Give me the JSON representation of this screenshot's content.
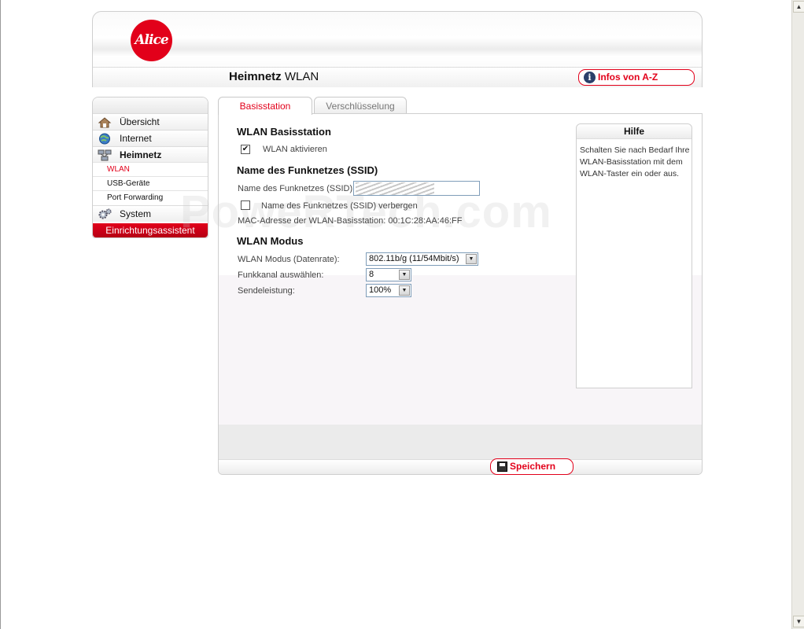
{
  "header": {
    "logo_text": "Alice",
    "page_title_bold": "Heimnetz",
    "page_title_rest": " WLAN",
    "infos_button": "Infos von A-Z"
  },
  "sidebar": {
    "items": [
      {
        "label": "Übersicht",
        "icon": "home-icon"
      },
      {
        "label": "Internet",
        "icon": "globe-icon"
      },
      {
        "label": "Heimnetz",
        "icon": "network-icon"
      }
    ],
    "subitems": [
      {
        "label": "WLAN",
        "active": true
      },
      {
        "label": "USB-Geräte",
        "active": false
      },
      {
        "label": "Port Forwarding",
        "active": false
      }
    ],
    "system": {
      "label": "System",
      "icon": "gear-icon"
    },
    "wizard": "Einrichtungsassistent"
  },
  "tabs": [
    {
      "label": "Basisstation",
      "active": true
    },
    {
      "label": "Verschlüsselung",
      "active": false
    }
  ],
  "content": {
    "section1_title": "WLAN Basisstation",
    "wlan_enable_label": "WLAN aktivieren",
    "wlan_enable_checked": true,
    "section2_title": "Name des Funknetzes (SSID)",
    "ssid_label": "Name des Funknetzes (SSID):",
    "ssid_hide_label": "Name des Funknetzes (SSID) verbergen",
    "ssid_hide_checked": false,
    "mac_text": "MAC-Adresse der WLAN-Basisstation: 00:1C:28:AA:46:FF",
    "section3_title": "WLAN Modus",
    "mode_label": "WLAN Modus (Datenrate):",
    "mode_value": "802.11b/g (11/54Mbit/s)",
    "channel_label": "Funkkanal auswählen:",
    "channel_value": "8",
    "power_label": "Sendeleistung:",
    "power_value": "100%"
  },
  "help": {
    "title": "Hilfe",
    "text": "Schalten Sie nach Bedarf Ihre WLAN-Basisstation mit dem WLAN-Taster ein oder aus."
  },
  "footer": {
    "save_label": "Speichern"
  },
  "watermark": "PoweRTech.com",
  "colors": {
    "accent": "#e2001a"
  }
}
